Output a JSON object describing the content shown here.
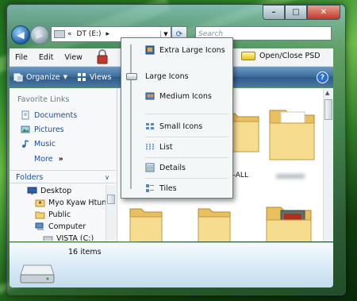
{
  "window": {
    "caption_buttons": {
      "minimize": "–",
      "maximize": "□",
      "close": "✕"
    }
  },
  "nav": {
    "back_icon": "back-arrow-icon",
    "forward_icon": "forward-arrow-icon",
    "address_segments": [
      "«",
      "DT (E:)",
      "▸"
    ],
    "refresh_icon": "refresh-icon",
    "search_placeholder": "Search"
  },
  "menubar": {
    "items": [
      "File",
      "Edit",
      "View"
    ],
    "extra_label": "Open/Close PSD"
  },
  "toolbar": {
    "organize": "Organize",
    "views": "Views",
    "help": "?"
  },
  "nav_pane": {
    "favorites_title": "Favorite Links",
    "favorites": [
      "Documents",
      "Pictures",
      "Music"
    ],
    "more": "More",
    "more_chevron": "»",
    "folders_title": "Folders",
    "folders_chevron": "∨",
    "tree": [
      "Desktop",
      "Myo Kyaw Htun",
      "Public",
      "Computer",
      "VISTA (C:)"
    ]
  },
  "content": {
    "folder_label_partial": "0-ALL"
  },
  "views_menu": {
    "items": [
      "Extra Large Icons",
      "Large Icons",
      "Medium Icons",
      "Small Icons",
      "List",
      "Details",
      "Tiles"
    ],
    "selected": "Large Icons"
  },
  "details_pane": {
    "item_count": "16 items"
  },
  "colors": {
    "accent": "#1a4e9e",
    "toolbar": "#3c6a98",
    "folder": "#f2d27a"
  }
}
